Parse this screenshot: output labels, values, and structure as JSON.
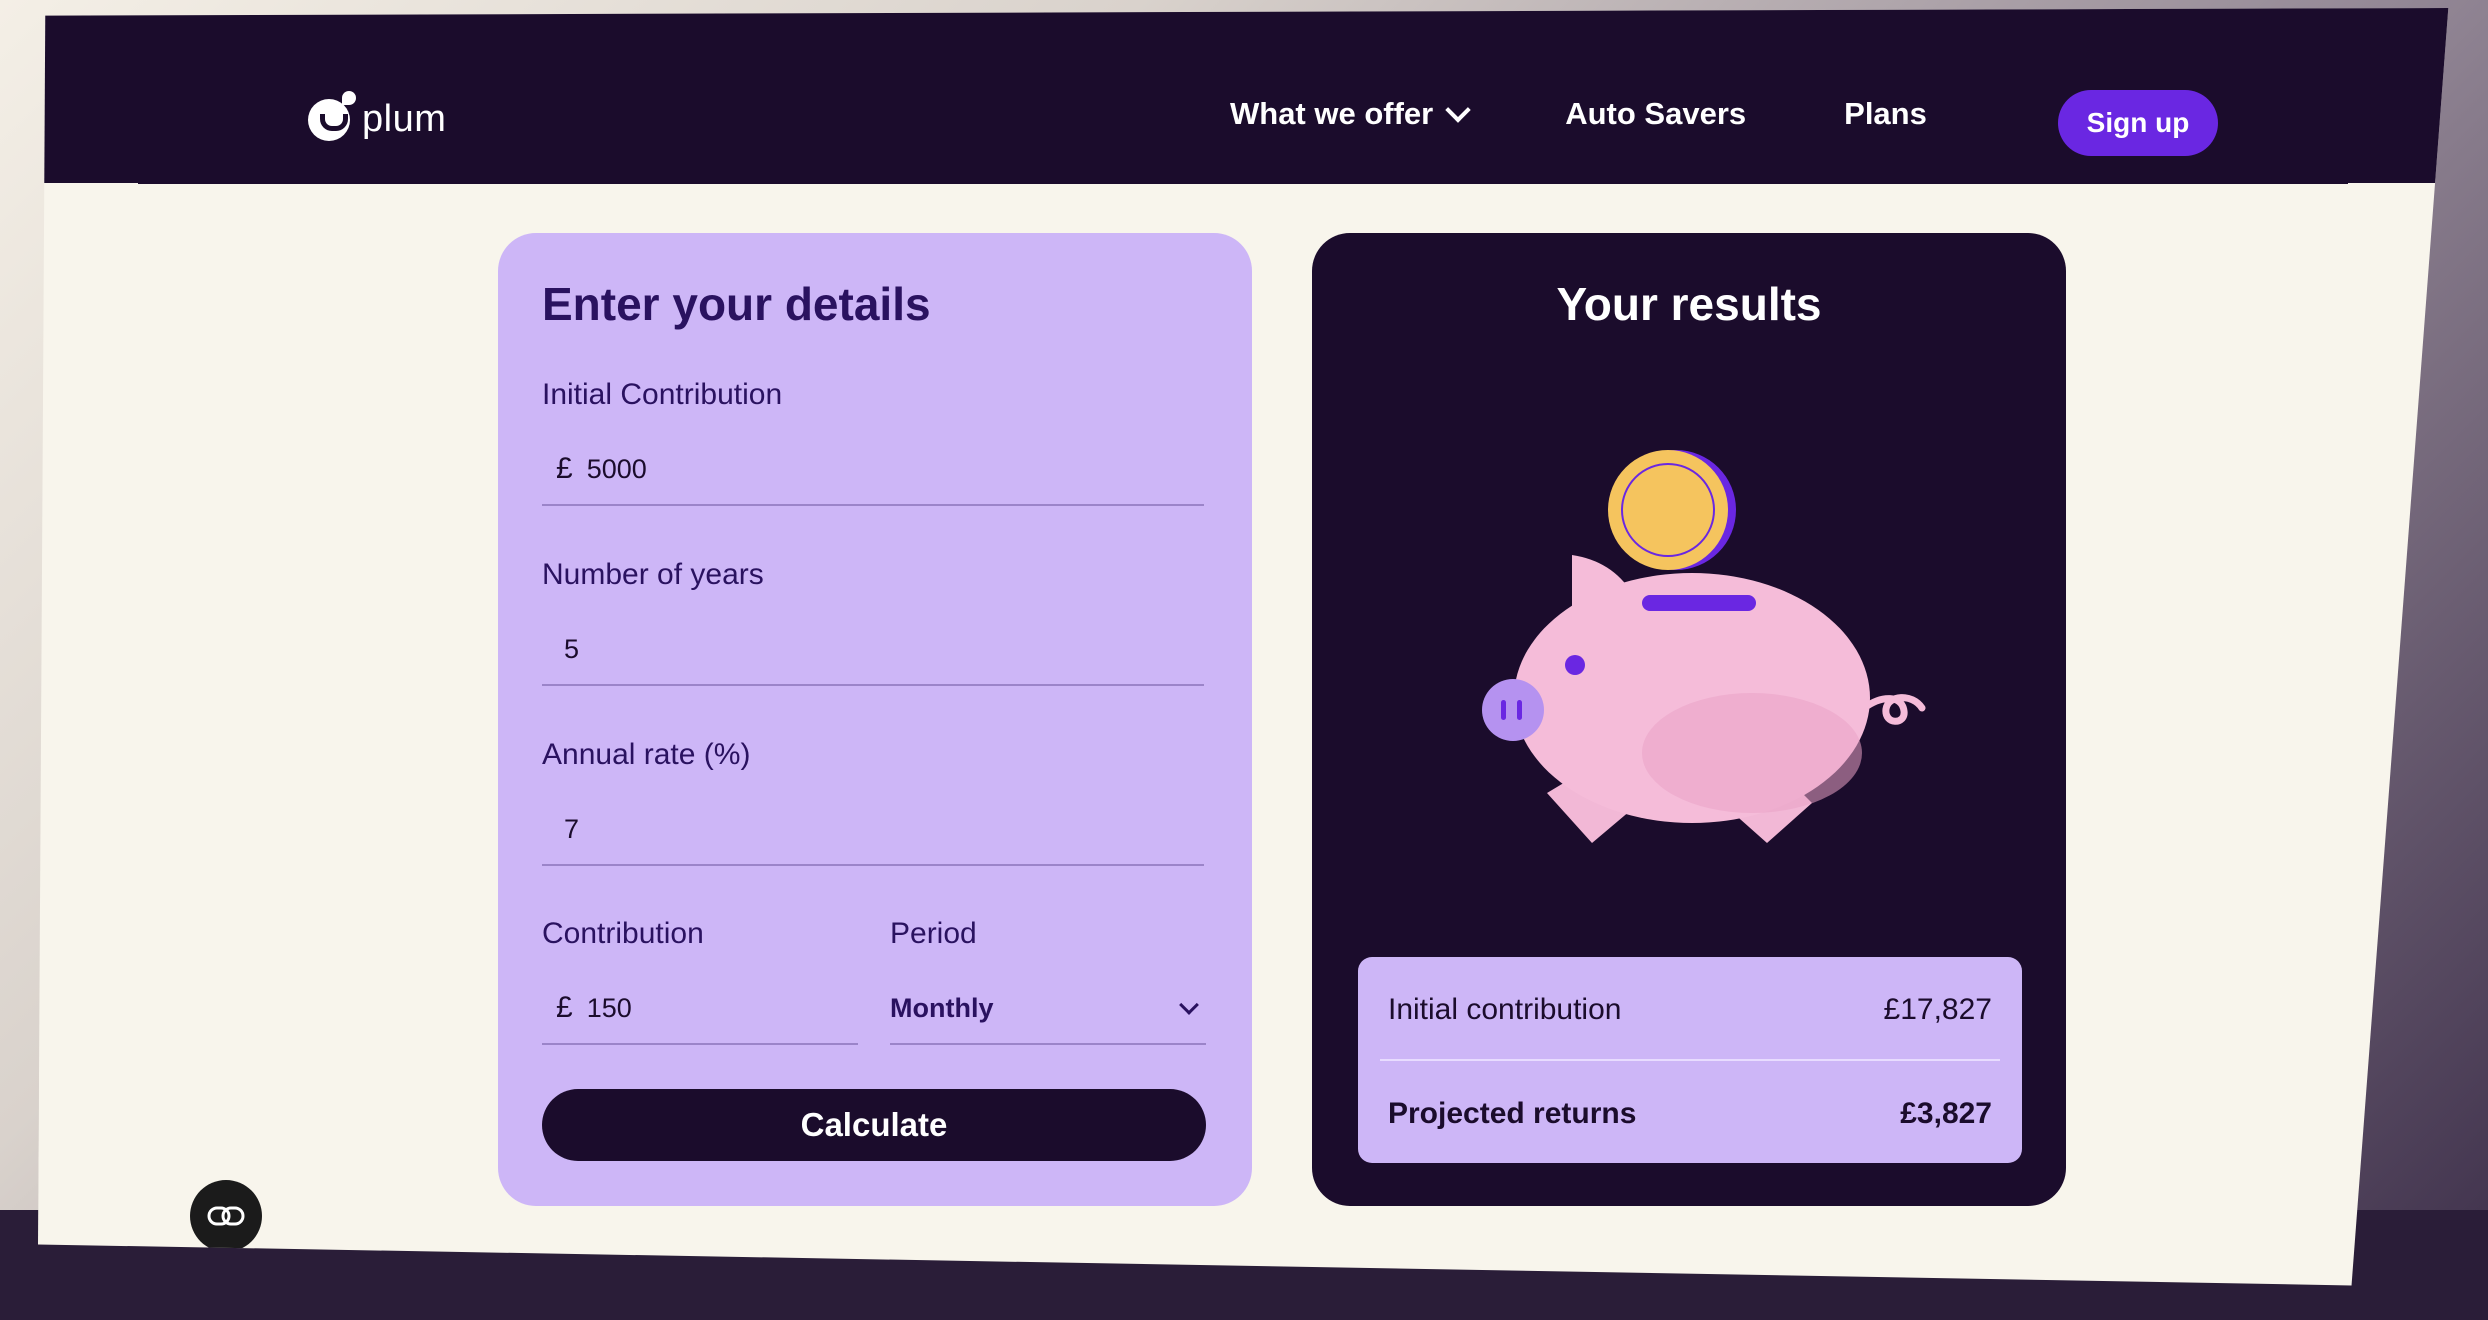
{
  "brand": {
    "name": "plum",
    "accent": "#6a27e2",
    "dark": "#1b0c2c",
    "lavender": "#cdb6f7"
  },
  "nav": {
    "items": [
      {
        "label": "What we offer",
        "has_dropdown": true
      },
      {
        "label": "Auto Savers"
      },
      {
        "label": "Plans"
      }
    ],
    "signup_label": "Sign up"
  },
  "details": {
    "title": "Enter your details",
    "initial": {
      "label": "Initial Contribution",
      "currency": "£",
      "value": "5000"
    },
    "years": {
      "label": "Number of years",
      "value": "5"
    },
    "rate": {
      "label": "Annual rate (%)",
      "value": "7"
    },
    "contribution": {
      "label": "Contribution",
      "currency": "£",
      "value": "150"
    },
    "period": {
      "label": "Period",
      "value": "Monthly"
    },
    "calculate_label": "Calculate"
  },
  "results": {
    "title": "Your results",
    "illustration": "piggy-bank-with-coin",
    "rows": [
      {
        "label": "Initial contribution",
        "value": "£17,827"
      },
      {
        "label": "Projected returns",
        "value": "£3,827"
      }
    ]
  },
  "chat": {
    "icon": "chat-icon"
  }
}
